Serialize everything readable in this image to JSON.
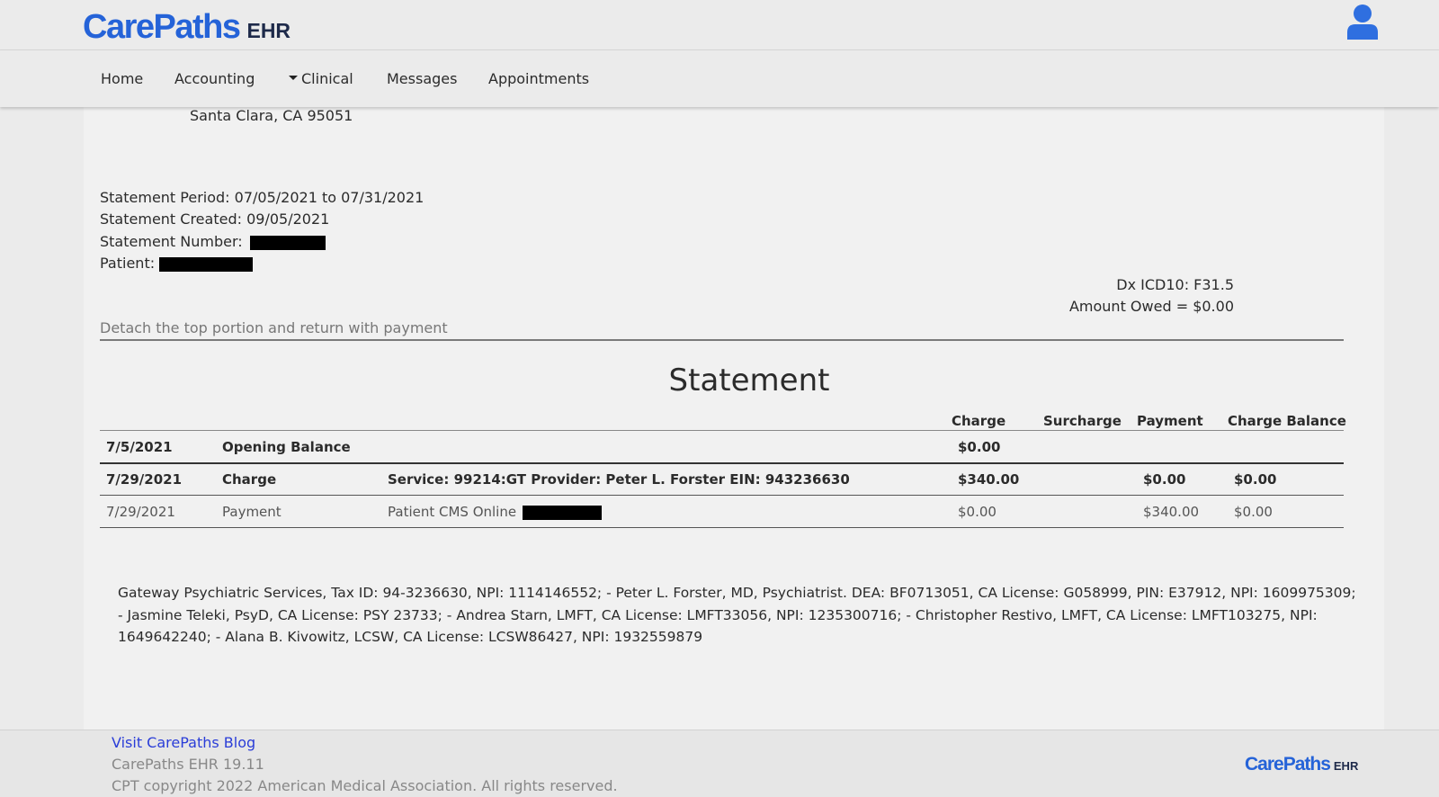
{
  "header": {
    "logo_main": "CarePaths",
    "logo_sub": "EHR",
    "user_icon": "user-icon"
  },
  "nav": {
    "items": [
      "Home",
      "Accounting",
      "Clinical",
      "Messages",
      "Appointments"
    ]
  },
  "address_line": "Santa Clara, CA 95051",
  "statement_info": {
    "period_label": "Statement Period:",
    "period_value": "07/05/2021 to 07/31/2021",
    "created_label": "Statement Created:",
    "created_value": "09/05/2021",
    "number_label": "Statement Number:",
    "patient_label": "Patient:",
    "dx": "Dx ICD10: F31.5",
    "amount_owed": "Amount Owed = $0.00",
    "detach_note": "Detach the top portion and return with payment"
  },
  "statement": {
    "title": "Statement",
    "columns": [
      "Charge",
      "Surcharge",
      "Payment",
      "Charge Balance"
    ],
    "rows": [
      {
        "date": "7/5/2021",
        "type": "Opening Balance",
        "description": "",
        "charge": "$0.00",
        "surcharge": "",
        "payment": "",
        "balance": ""
      },
      {
        "date": "7/29/2021",
        "type": "Charge",
        "description": "Service: 99214:GT Provider: Peter L. Forster EIN: 943236630",
        "charge": "$340.00",
        "surcharge": "",
        "payment": "$0.00",
        "balance": "$0.00"
      },
      {
        "date": "7/29/2021",
        "type": "Payment",
        "description": "Patient CMS Online",
        "charge": "$0.00",
        "surcharge": "",
        "payment": "$340.00",
        "balance": "$0.00"
      }
    ]
  },
  "providers_text": "Gateway Psychiatric Services, Tax ID: 94-3236630, NPI: 1114146552; - Peter L. Forster, MD, Psychiatrist. DEA: BF0713051, CA License: G058999, PIN: E37912, NPI: 1609975309; - Jasmine Teleki, PsyD, CA License: PSY 23733; - Andrea Starn, LMFT, CA License: LMFT33056, NPI: 1235300716; - Christopher Restivo, LMFT, CA License: LMFT103275, NPI: 1649642240; - Alana B. Kivowitz, LCSW, CA License: LCSW86427, NPI: 1932559879",
  "footer": {
    "blog_link": "Visit CarePaths Blog",
    "version": "CarePaths EHR 19.11",
    "copyright": "CPT copyright 2022 American Medical Association. All rights reserved.",
    "logo_main": "CarePaths",
    "logo_sub": "EHR"
  },
  "colors": {
    "brand_blue": "#2563d8",
    "link_blue": "#2a3dd8"
  }
}
